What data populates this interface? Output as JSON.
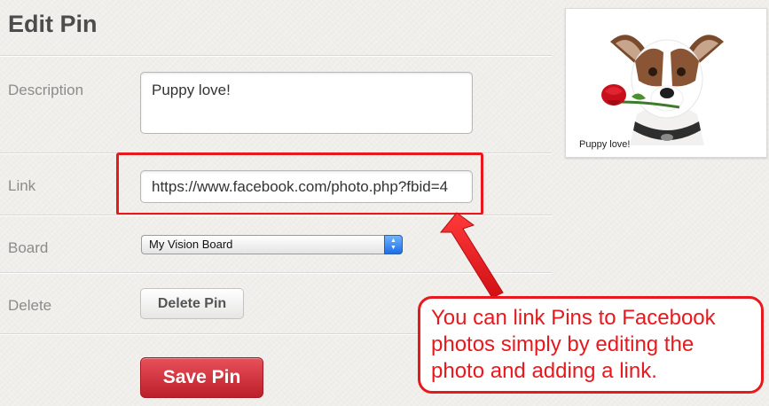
{
  "page": {
    "title": "Edit Pin"
  },
  "form": {
    "description_label": "Description",
    "description_value": "Puppy love!",
    "link_label": "Link",
    "link_value": "https://www.facebook.com/photo.php?fbid=4",
    "board_label": "Board",
    "board_selected": "My Vision Board",
    "delete_label": "Delete",
    "delete_button": "Delete Pin",
    "save_button": "Save Pin"
  },
  "preview": {
    "caption": "Puppy love!"
  },
  "annotation": {
    "text": "You can link Pins to Facebook photos simply by editing the photo and adding a link.",
    "color": "#e8191e"
  },
  "colors": {
    "accent": "#e8191e",
    "save_button": "#cb2027"
  }
}
